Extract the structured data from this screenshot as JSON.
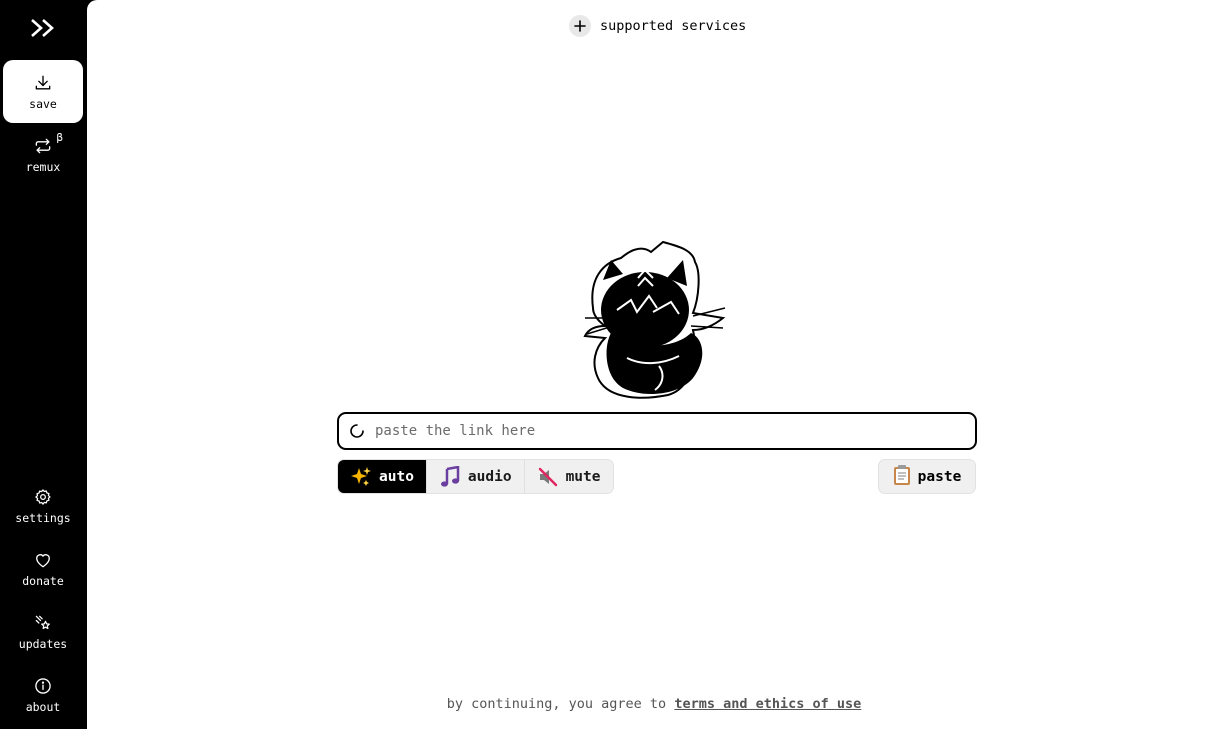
{
  "sidebar": {
    "logo_icon": "double-chevron-right-icon",
    "items": [
      {
        "label": "save",
        "icon": "download-icon",
        "active": true
      },
      {
        "label": "remux",
        "icon": "repeat-icon",
        "badge": "β"
      },
      {
        "label": "settings",
        "icon": "gear-icon"
      },
      {
        "label": "donate",
        "icon": "heart-icon"
      },
      {
        "label": "updates",
        "icon": "sparkle-comet-icon"
      },
      {
        "label": "about",
        "icon": "info-icon"
      }
    ]
  },
  "header": {
    "services_label": "supported services",
    "services_icon": "plus-icon"
  },
  "input": {
    "placeholder": "paste the link here",
    "value": "",
    "icon": "loading-spinner-icon"
  },
  "modes": [
    {
      "label": "auto",
      "icon": "sparkles-icon",
      "selected": true
    },
    {
      "label": "audio",
      "icon": "music-notes-icon",
      "selected": false
    },
    {
      "label": "mute",
      "icon": "muted-icon",
      "selected": false
    }
  ],
  "paste": {
    "label": "paste",
    "icon": "clipboard-icon"
  },
  "footer": {
    "prefix": "by continuing, you agree to",
    "link": "terms and ethics of use"
  },
  "colors": {
    "accent": "#000000",
    "background": "#ffffff",
    "sidebar": "#000000"
  }
}
